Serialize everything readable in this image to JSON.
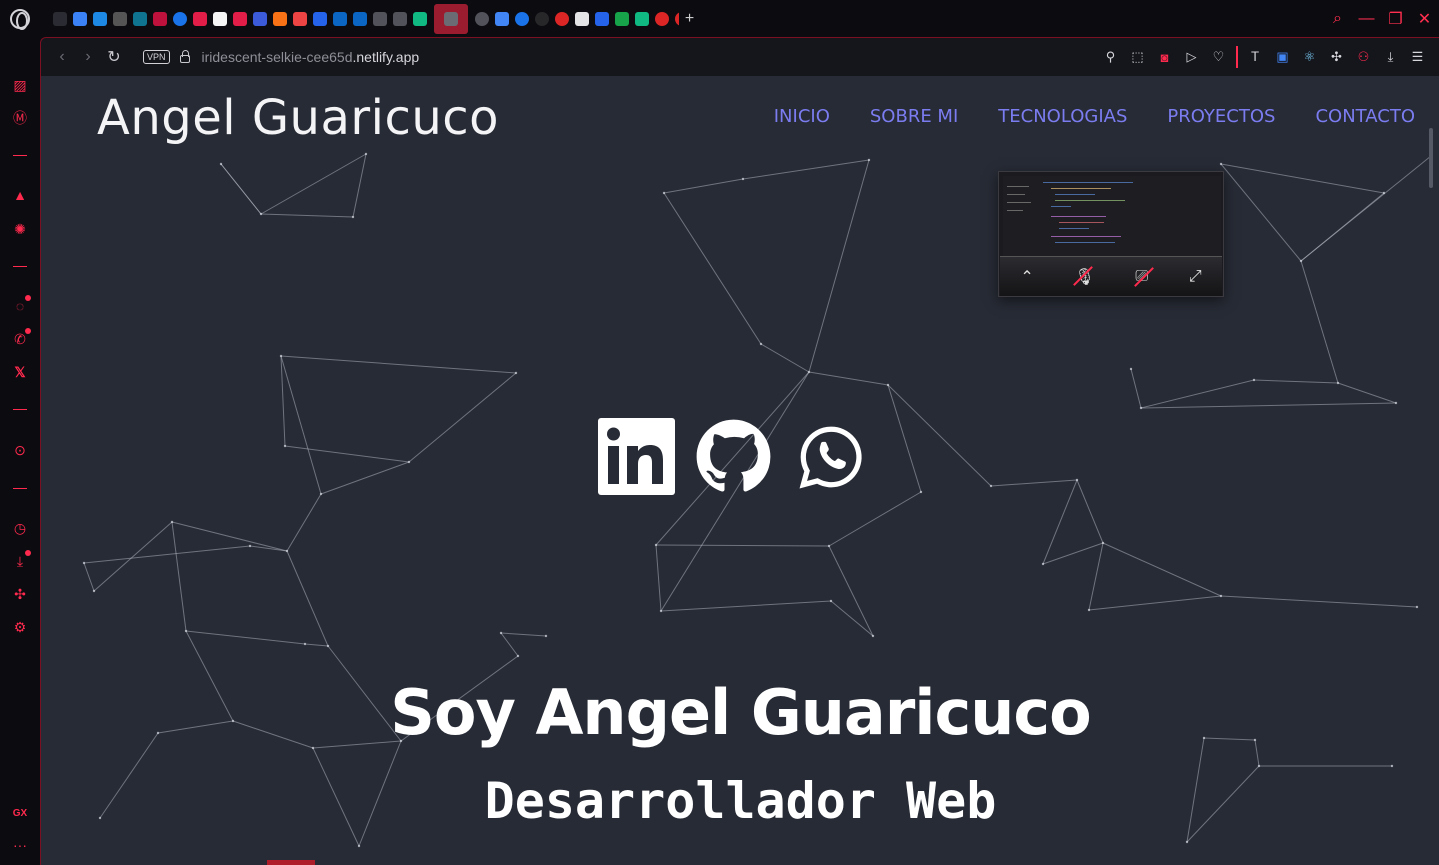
{
  "browser": {
    "tabs": [
      {
        "icon": "gamepad-icon",
        "color": "#2b2b33"
      },
      {
        "icon": "pocket-icon",
        "color": "#3b82f6"
      },
      {
        "icon": "c-icon",
        "color": "#1e88e5"
      },
      {
        "icon": "dumbbell-icon",
        "color": "#555"
      },
      {
        "icon": "react-icon",
        "color": "#0e7490"
      },
      {
        "icon": "react-red-icon",
        "color": "#be123c"
      },
      {
        "icon": "google-icon",
        "color": "#1a73e8"
      },
      {
        "icon": "youtube-icon",
        "color": "#e11d48"
      },
      {
        "icon": "blank-icon",
        "color": "#f5f5f5"
      },
      {
        "icon": "youtube-icon",
        "color": "#e11d48"
      },
      {
        "icon": "azure-icon",
        "color": "#3b5bdb"
      },
      {
        "icon": "adobe-icon",
        "color": "#f97316"
      },
      {
        "icon": "gmail-icon",
        "color": "#ef4444"
      },
      {
        "icon": "shield-icon",
        "color": "#2563eb"
      },
      {
        "icon": "linkedin-icon",
        "color": "#0a66c2"
      },
      {
        "icon": "linkedin-icon",
        "color": "#0a66c2"
      },
      {
        "icon": "nc-icon",
        "color": "#52525b"
      },
      {
        "icon": "ag-icon",
        "color": "#52525b"
      },
      {
        "icon": "diamond-icon",
        "color": "#10b981"
      },
      {
        "icon": "ag-icon",
        "color": "#6b6b73",
        "active": true
      },
      {
        "icon": "globe-icon",
        "color": "#52525b"
      },
      {
        "icon": "translate-icon",
        "color": "#4285f4"
      },
      {
        "icon": "google-icon",
        "color": "#1a73e8"
      },
      {
        "icon": "github-icon",
        "color": "#27272a"
      },
      {
        "icon": "pokeball-icon",
        "color": "#dc2626"
      },
      {
        "icon": "panda-icon",
        "color": "#e4e4e7"
      },
      {
        "icon": "ts-icon",
        "color": "#2563eb"
      },
      {
        "icon": "chrome-icon",
        "color": "#16a34a"
      },
      {
        "icon": "diamond-icon",
        "color": "#10b981"
      },
      {
        "icon": "pokeball-icon",
        "color": "#dc2626"
      },
      {
        "icon": "pokeball-icon",
        "color": "#dc2626"
      },
      {
        "icon": "pokeball-icon",
        "color": "#dc2626"
      },
      {
        "icon": "globe-icon",
        "color": "#52525b"
      },
      {
        "icon": "google-icon",
        "color": "#1a73e8"
      },
      {
        "icon": "google-icon",
        "color": "#1a73e8"
      },
      {
        "icon": "speed-icon",
        "color": "#3f3f46"
      },
      {
        "icon": "hand-icon",
        "color": "#a16207"
      },
      {
        "icon": "swift-icon",
        "color": "#f97316"
      },
      {
        "icon": "globe-icon",
        "color": "#52525b"
      },
      {
        "icon": "linkedin-icon",
        "color": "#0a66c2"
      },
      {
        "icon": "angular-icon",
        "color": "#dc2626"
      },
      {
        "icon": "s-icon",
        "color": "#7c3aed"
      },
      {
        "icon": "s-icon",
        "color": "#7c3aed"
      },
      {
        "icon": "ag-icon",
        "color": "#52525b"
      },
      {
        "icon": "kx-icon",
        "color": "#eab308"
      },
      {
        "icon": "google-icon",
        "color": "#1a73e8"
      },
      {
        "icon": "kx-icon",
        "color": "#eab308"
      },
      {
        "icon": "ag-icon",
        "color": "#52525b"
      },
      {
        "icon": "grid-icon",
        "color": "#3f3f46"
      },
      {
        "icon": "translate-icon",
        "color": "#4285f4"
      },
      {
        "icon": "ag-icon",
        "color": "#52525b"
      },
      {
        "icon": "pocket-icon",
        "color": "#3b82f6"
      },
      {
        "icon": "ag-icon",
        "color": "#52525b"
      },
      {
        "icon": "ag-icon",
        "color": "#52525b"
      },
      {
        "icon": "google-icon",
        "color": "#1a73e8"
      },
      {
        "icon": "heart-icon",
        "color": "#e11d48"
      },
      {
        "icon": "tiktok-icon",
        "color": "#18181b"
      },
      {
        "icon": "github-icon",
        "color": "#27272a"
      },
      {
        "icon": "google-icon",
        "color": "#1a73e8"
      },
      {
        "icon": "translate-icon",
        "color": "#4285f4"
      },
      {
        "icon": "google-icon",
        "color": "#1a73e8"
      }
    ],
    "newtab_label": "+",
    "url_prefix": "iridescent-selkie-cee65d",
    "url_domain": ".netlify.app",
    "vpn_label": "VPN",
    "accent": "#ff2a4d"
  },
  "site": {
    "title": "Angel Guaricuco",
    "nav": [
      "INICIO",
      "SOBRE MI",
      "TECNOLOGIAS",
      "PROYECTOS",
      "CONTACTO"
    ],
    "hero_name": "Soy Angel Guaricuco",
    "hero_role": "Desarrollador Web",
    "nav_color": "#7b7cf0",
    "background": "#272b35"
  }
}
